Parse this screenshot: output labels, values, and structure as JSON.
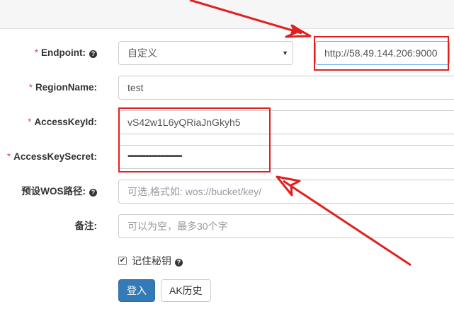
{
  "form": {
    "endpoint": {
      "required_mark": "*",
      "label": "Endpoint:",
      "help_icon": "question-circle-icon",
      "select_value": "自定义",
      "url_value": "http://58.49.144.206:9000"
    },
    "region": {
      "required_mark": "*",
      "label": "RegionName:",
      "value": "test"
    },
    "access_key_id": {
      "required_mark": "*",
      "label": "AccessKeyId:",
      "value": "vS42w1L6yQRiaJnGkyh5"
    },
    "access_key_secret": {
      "required_mark": "*",
      "label": "AccessKeySecret:",
      "value": "••••••••••••••••••••••••••••••••••••••••"
    },
    "wos_path": {
      "label": "预设WOS路径:",
      "help_icon": "question-circle-icon",
      "placeholder": "可选,格式如: wos://bucket/key/"
    },
    "remark": {
      "label": "备注:",
      "placeholder": "可以为空，最多30个字"
    },
    "remember": {
      "checked": true,
      "label": "记住秘钥",
      "help_icon": "question-circle-icon"
    },
    "login_button": "登入",
    "history_button": "AK历史"
  },
  "annotations": {
    "highlight_color": "#e02020"
  }
}
